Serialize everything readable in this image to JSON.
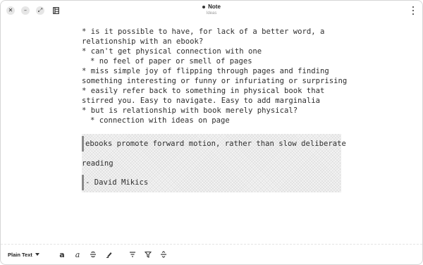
{
  "window": {
    "title": "Note",
    "subtitle": "Ideas"
  },
  "icons": {
    "close": "close-icon",
    "minimize": "minimize-icon",
    "maximize": "maximize-icon",
    "sidebar": "sidebar-toggle-icon",
    "menu": "more-vertical-icon"
  },
  "content": {
    "lines": [
      "* is it possible to have, for lack of a better word, a",
      "relationship with an ebook?",
      "* can't get physical connection with one",
      "* no feel of paper or smell of pages",
      "* miss simple joy of flipping through pages and finding",
      "something interesting or funny or infuriating or surprising",
      "* easily refer back to something in physical book that",
      "stirred you. Easy to navigate. Easy to add marginalia",
      "* but is relationship with book merely physical?",
      "* connection with ideas on page"
    ],
    "quote": {
      "line1": "ebooks promote forward motion, rather than slow deliberate",
      "line2": "reading",
      "line3": "- David Mikics"
    }
  },
  "footer": {
    "format_label": "Plain Text"
  },
  "colors": {
    "text": "#2e2e2e",
    "quote_bar": "#8a8a8a",
    "quote_bg": "#f4f4f4"
  }
}
